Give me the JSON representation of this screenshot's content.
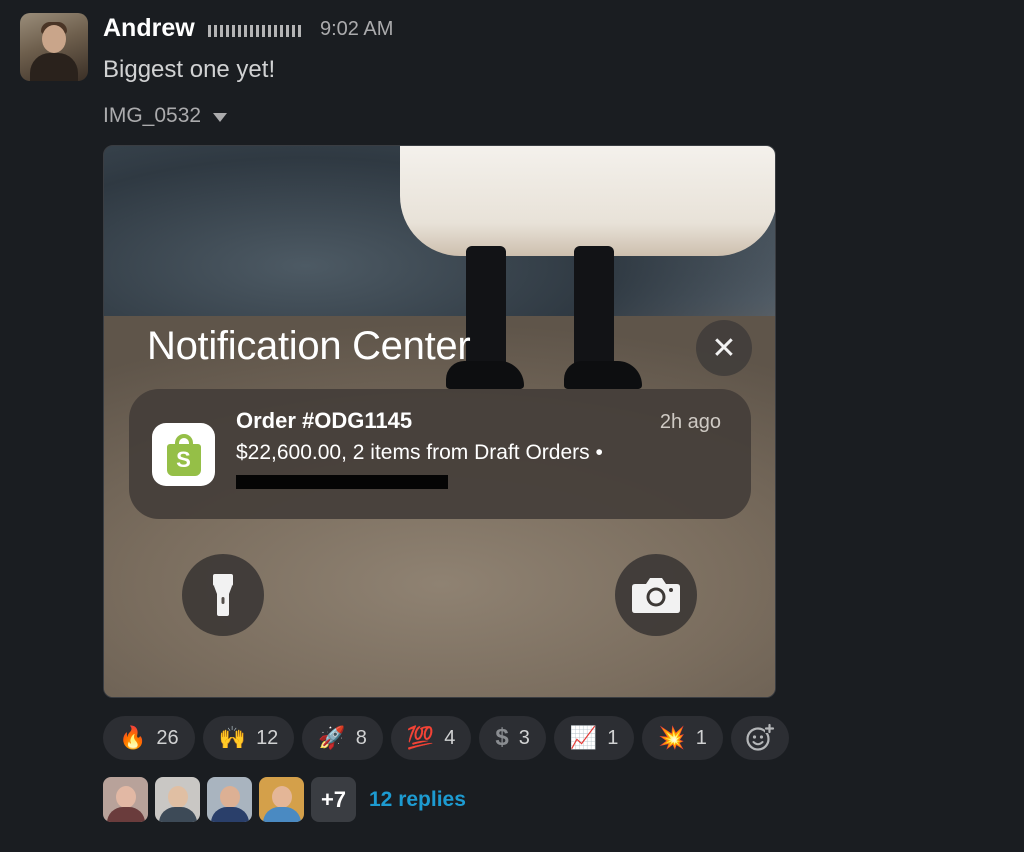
{
  "message": {
    "author": "Andrew",
    "time": "9:02 AM",
    "text": "Biggest one yet!"
  },
  "attachment": {
    "filename": "IMG_0532",
    "notification_center": {
      "title": "Notification Center",
      "close_icon": "close-icon",
      "notification": {
        "app_icon": "shopify-bag-icon",
        "title": "Order #ODG1145",
        "time": "2h ago",
        "body": "$22,600.00, 2 items from Draft Orders •"
      },
      "quick_actions": [
        "flashlight-icon",
        "camera-icon"
      ]
    }
  },
  "reactions": [
    {
      "emoji": "🔥",
      "count": "26"
    },
    {
      "emoji": "🙌",
      "count": "12"
    },
    {
      "emoji": "🚀",
      "count": "8"
    },
    {
      "emoji": "💯",
      "count": "4"
    },
    {
      "emoji": "$",
      "count": "3"
    },
    {
      "emoji": "📈",
      "count": "1"
    },
    {
      "emoji": "💥",
      "count": "1"
    }
  ],
  "thread": {
    "more_count": "+7",
    "replies_label": "12 replies"
  },
  "colors": {
    "background": "#1a1d21",
    "link": "#1d9bd1",
    "shopify_green": "#95bf47",
    "reaction_pill": "#2c2e33"
  }
}
